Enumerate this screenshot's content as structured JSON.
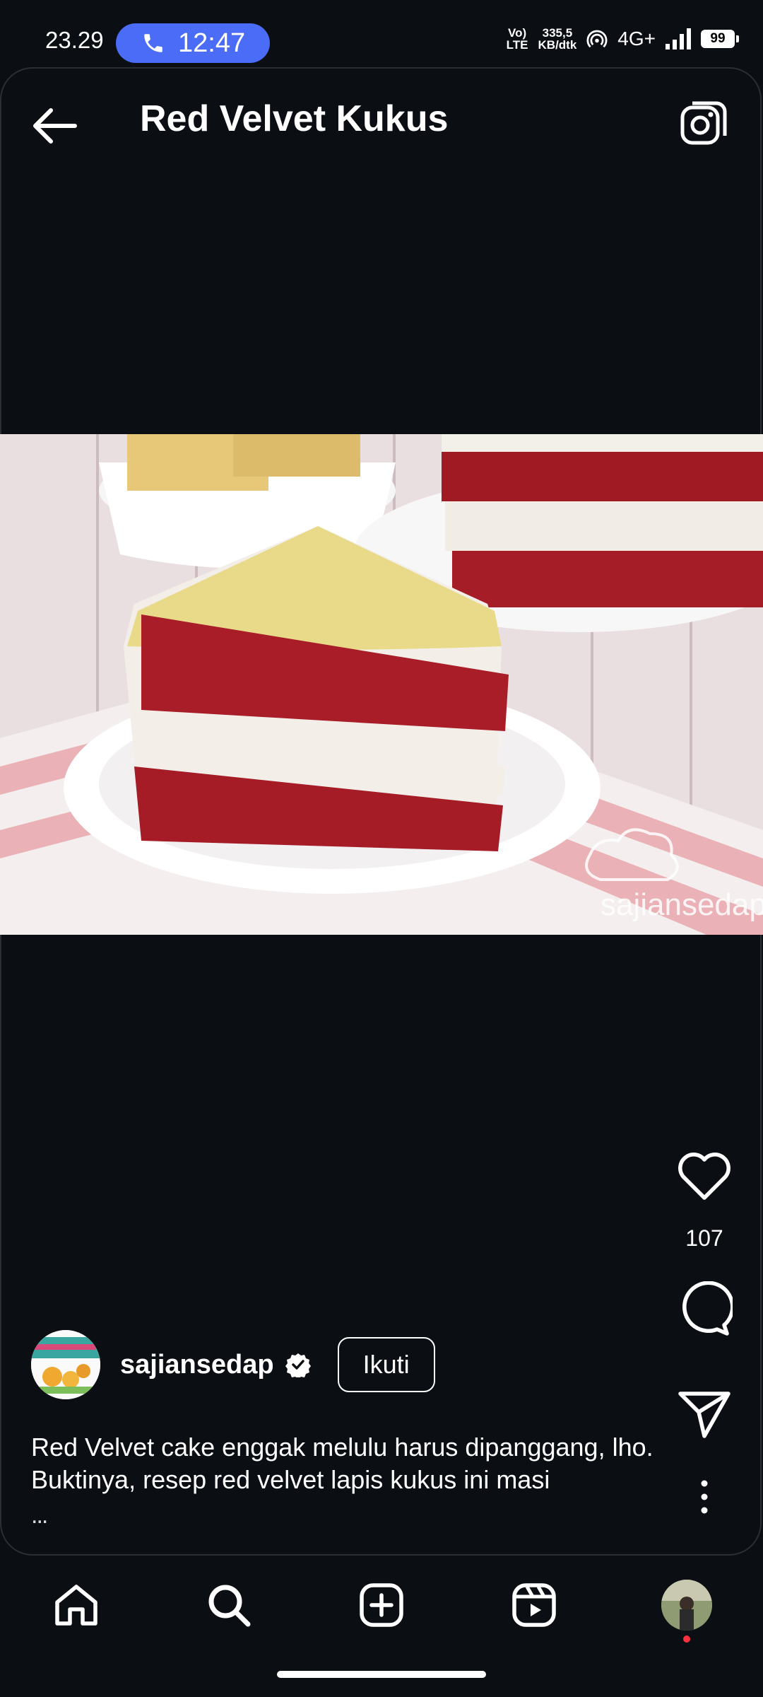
{
  "status": {
    "time": "23.29",
    "call_time": "12:47",
    "network_top": "335,5",
    "network_bottom": "KB/dtk",
    "volte_top": "Vo)",
    "volte_bottom": "LTE",
    "network_type": "4G+",
    "battery": "99"
  },
  "header": {
    "title": "Red Velvet Kukus"
  },
  "post": {
    "watermark": "sajiansedap",
    "like_count": "107",
    "author": {
      "username": "sajiansedap",
      "follow_label": "Ikuti"
    },
    "caption": "Red Velvet cake enggak melulu harus dipanggang, lho. Buktinya, resep red velvet lapis kukus ini masi",
    "caption_more": "..."
  },
  "nav": {
    "items": [
      "home",
      "search",
      "create",
      "reels",
      "profile"
    ]
  },
  "colors": {
    "background": "#0b0f14",
    "accent_call": "#4a6cf7",
    "notification": "#ff3040"
  }
}
